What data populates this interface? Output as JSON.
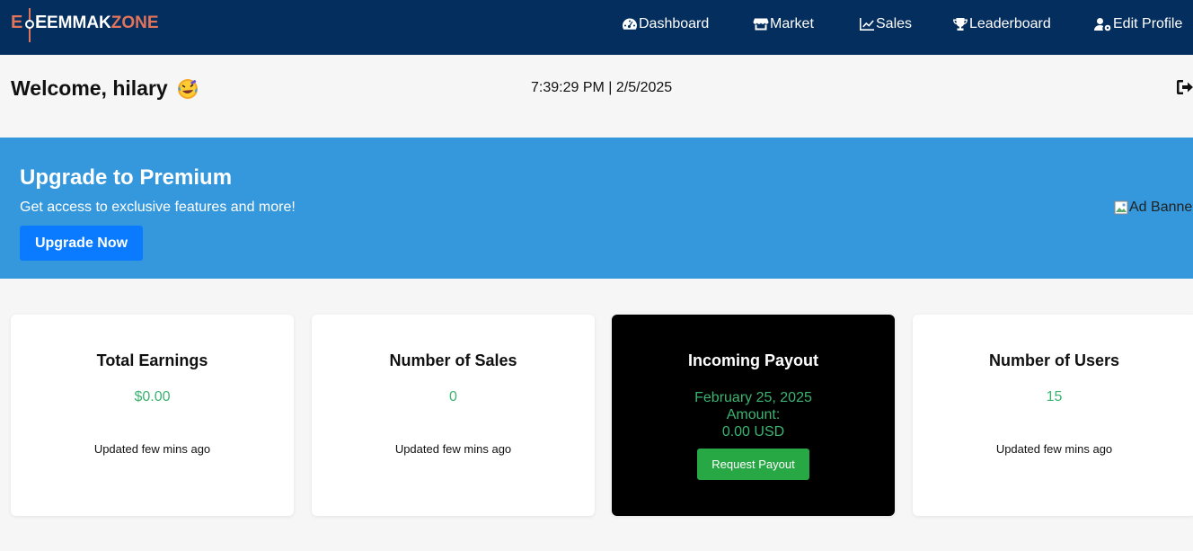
{
  "nav": {
    "brand": {
      "mark_left": "E",
      "mark_right": "E",
      "word_white": "EMMAK",
      "word_orange": "ZONE"
    },
    "items": [
      {
        "label": "Dashboard",
        "icon": "gauge-icon"
      },
      {
        "label": "Market",
        "icon": "store-icon"
      },
      {
        "label": "Sales",
        "icon": "chart-line-icon"
      },
      {
        "label": "Leaderboard",
        "icon": "trophy-icon"
      },
      {
        "label": "Edit Profile",
        "icon": "user-gear-icon"
      }
    ]
  },
  "welcome": {
    "text": "Welcome, hilary",
    "emoji": "rolling-laughing-emoji"
  },
  "datetime": "7:39:29 PM | 2/5/2025",
  "banner": {
    "title": "Upgrade to Premium",
    "subtitle": "Get access to exclusive features and more!",
    "button": "Upgrade Now",
    "ad_alt": "Ad Banner"
  },
  "cards": [
    {
      "title": "Total Earnings",
      "value": "$0.00",
      "updated": "Updated few mins ago"
    },
    {
      "title": "Number of Sales",
      "value": "0",
      "updated": "Updated few mins ago"
    },
    {
      "title": "Incoming Payout",
      "date": "February 25, 2025",
      "amount_label": "Amount:",
      "amount": "0.00 USD",
      "button": "Request Payout"
    },
    {
      "title": "Number of Users",
      "value": "15",
      "updated": "Updated few mins ago"
    }
  ],
  "colors": {
    "navbar": "#042e5e",
    "brand_accent": "#e0735a",
    "banner": "#3598dc",
    "primary_button": "#0a7bff",
    "success": "#28a745",
    "value_green": "#3cb371"
  }
}
